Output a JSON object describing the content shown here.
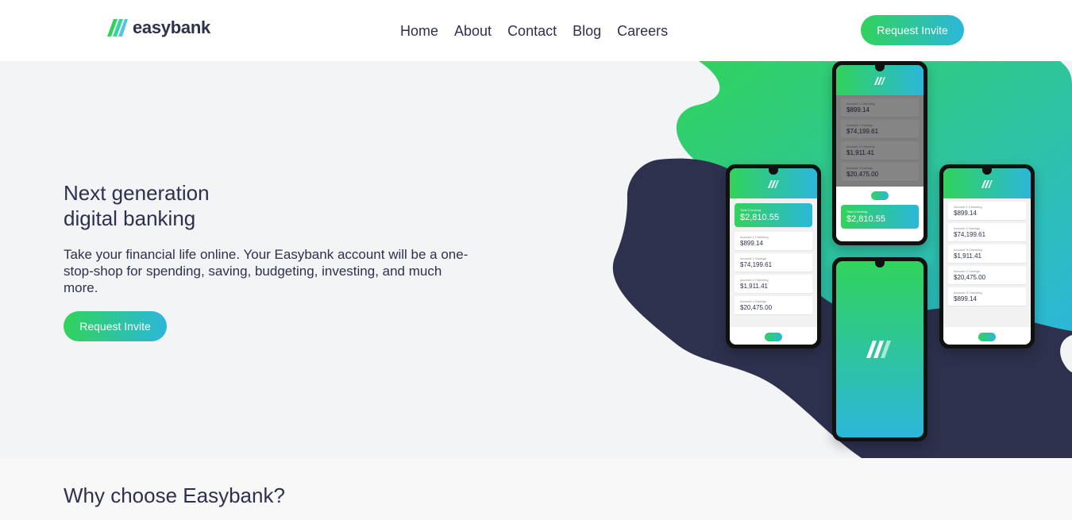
{
  "header": {
    "logo_text": "easybank",
    "nav": [
      "Home",
      "About",
      "Contact",
      "Blog",
      "Careers"
    ],
    "cta_label": "Request Invite"
  },
  "hero": {
    "title_line1": "Next generation",
    "title_line2": "digital banking",
    "description": "Take your financial life online. Your Easybank account will be a one-stop-shop for spending, saving, budgeting, investing, and much more.",
    "cta_label": "Request Invite"
  },
  "phones": {
    "top": {
      "accounts": [
        {
          "label": "Account 1 Checking",
          "value": "$899.14"
        },
        {
          "label": "Account 2 Savings",
          "value": "$74,199.61"
        },
        {
          "label": "Account 3 Checking",
          "value": "$1,911.41"
        },
        {
          "label": "Account 4 Savings",
          "value": "$20,475.00"
        }
      ],
      "highlight": {
        "label": "Total Checking",
        "value": "$2,810.55"
      }
    },
    "left": {
      "highlight": {
        "label": "Total Checking",
        "value": "$2,810.55"
      },
      "accounts": [
        {
          "label": "Account 1 Checking",
          "value": "$899.14"
        },
        {
          "label": "Account 2 Savings",
          "value": "$74,199.61"
        },
        {
          "label": "Account 3 Checking",
          "value": "$1,911.41"
        },
        {
          "label": "Account 4 Savings",
          "value": "$20,475.00"
        }
      ]
    },
    "right": {
      "accounts": [
        {
          "label": "Account 1 Checking",
          "value": "$899.14"
        },
        {
          "label": "Account 2 Savings",
          "value": "$74,199.61"
        },
        {
          "label": "Account 3 Checking",
          "value": "$1,911.41"
        },
        {
          "label": "Account 4 Savings",
          "value": "$20,475.00"
        },
        {
          "label": "Account 5 Checking",
          "value": "$899.14"
        }
      ]
    }
  },
  "why": {
    "title": "Why choose Easybank?"
  },
  "colors": {
    "primary_dark": "#2d314d",
    "lime": "#31d35c",
    "cyan": "#2bb7da",
    "hero_bg": "#f3f4f6"
  }
}
